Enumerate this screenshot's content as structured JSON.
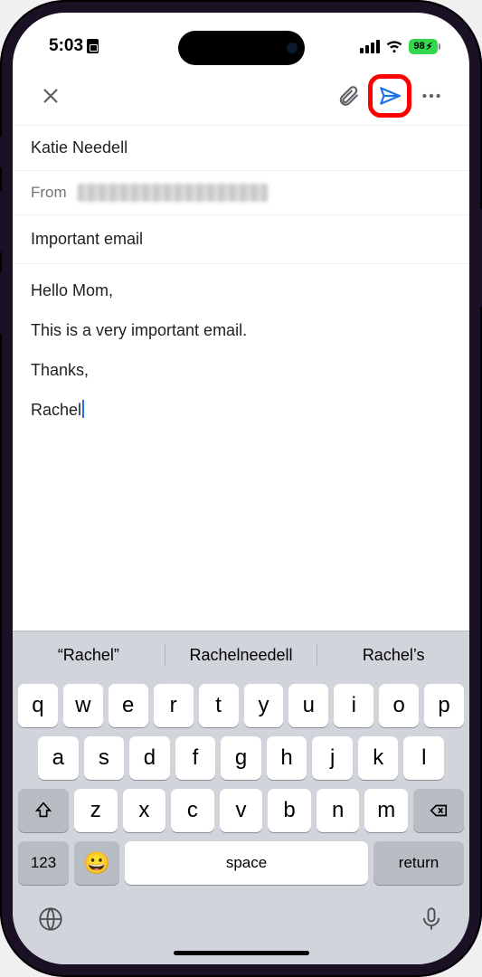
{
  "status": {
    "time": "5:03",
    "battery_pct": "98",
    "charging": true
  },
  "toolbar": {
    "close_name": "close",
    "attach_name": "attachment",
    "send_name": "send",
    "more_name": "more"
  },
  "compose": {
    "to": "Katie Needell",
    "from_label": "From",
    "from_redacted": true,
    "subject": "Important email",
    "body_lines": [
      "Hello Mom,",
      "This is a very important email.",
      "Thanks,",
      "Rachel"
    ]
  },
  "keyboard": {
    "suggestions": [
      "“Rachel”",
      "Rachelneedell",
      "Rachel’s"
    ],
    "rows": [
      [
        "q",
        "w",
        "e",
        "r",
        "t",
        "y",
        "u",
        "i",
        "o",
        "p"
      ],
      [
        "a",
        "s",
        "d",
        "f",
        "g",
        "h",
        "j",
        "k",
        "l"
      ],
      [
        "z",
        "x",
        "c",
        "v",
        "b",
        "n",
        "m"
      ]
    ],
    "numkey": "123",
    "space": "space",
    "return": "return"
  }
}
